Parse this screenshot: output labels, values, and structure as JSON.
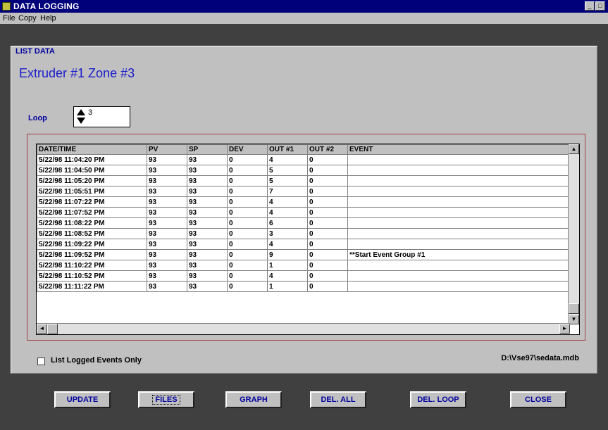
{
  "window": {
    "title": "DATA LOGGING",
    "minimize": "_",
    "maximize": "□"
  },
  "menu": [
    "File",
    "Copy",
    "Help"
  ],
  "section_label": "LIST DATA",
  "subtitle": "Extruder #1 Zone #3",
  "loop": {
    "label": "Loop",
    "value": "3"
  },
  "table": {
    "columns": [
      "DATE/TIME",
      "PV",
      "SP",
      "DEV",
      "OUT #1",
      "OUT #2",
      "EVENT"
    ],
    "rows": [
      [
        "5/22/98 11:04:20 PM",
        "93",
        "93",
        "0",
        "4",
        "0",
        ""
      ],
      [
        "5/22/98 11:04:50 PM",
        "93",
        "93",
        "0",
        "5",
        "0",
        ""
      ],
      [
        "5/22/98 11:05:20 PM",
        "93",
        "93",
        "0",
        "5",
        "0",
        ""
      ],
      [
        "5/22/98 11:05:51 PM",
        "93",
        "93",
        "0",
        "7",
        "0",
        ""
      ],
      [
        "5/22/98 11:07:22 PM",
        "93",
        "93",
        "0",
        "4",
        "0",
        ""
      ],
      [
        "5/22/98 11:07:52 PM",
        "93",
        "93",
        "0",
        "4",
        "0",
        ""
      ],
      [
        "5/22/98 11:08:22 PM",
        "93",
        "93",
        "0",
        "6",
        "0",
        ""
      ],
      [
        "5/22/98 11:08:52 PM",
        "93",
        "93",
        "0",
        "3",
        "0",
        ""
      ],
      [
        "5/22/98 11:09:22 PM",
        "93",
        "93",
        "0",
        "4",
        "0",
        ""
      ],
      [
        "5/22/98 11:09:52 PM",
        "93",
        "93",
        "0",
        "9",
        "0",
        "**Start Event Group #1"
      ],
      [
        "5/22/98 11:10:22 PM",
        "93",
        "93",
        "0",
        "1",
        "0",
        ""
      ],
      [
        "5/22/98 11:10:52 PM",
        "93",
        "93",
        "0",
        "4",
        "0",
        ""
      ],
      [
        "5/22/98 11:11:22 PM",
        "93",
        "93",
        "0",
        "1",
        "0",
        ""
      ]
    ]
  },
  "checkbox_label": "List Logged Events Only",
  "db_path": "D:\\Vse97\\sedata.mdb",
  "buttons": {
    "update": "UPDATE",
    "files": "FILES",
    "graph": "GRAPH",
    "del_all": "DEL. ALL",
    "del_loop": "DEL. LOOP",
    "close": "CLOSE"
  }
}
